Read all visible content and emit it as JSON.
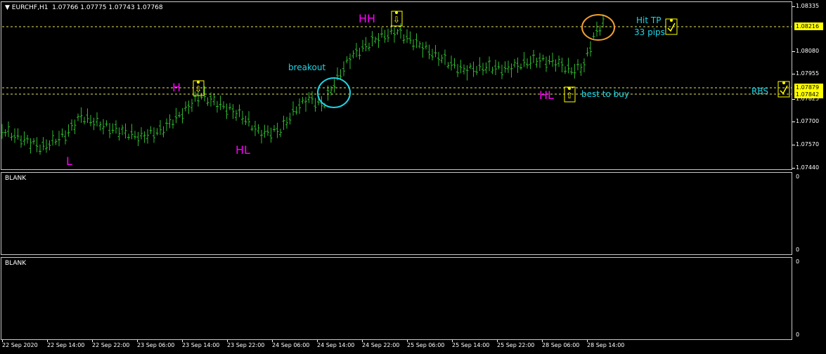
{
  "symbol_info": "EURCHF,H1  1.07766 1.07775 1.07743 1.07768",
  "colors": {
    "bars": "#2eb82e",
    "level_lines": "#e6e65a",
    "pink_text": "#ff00ff",
    "cyan_text": "#1ed6e6",
    "cyan_circle": "#1ed6e6",
    "orange_circle": "#f0a030",
    "marker_box": "#ffff00"
  },
  "price_scale": [
    "1.08335",
    "1.08080",
    "1.07955",
    "1.07825",
    "1.07700",
    "1.07570",
    "1.07440"
  ],
  "price_tags": [
    "1.08216",
    "1.07879",
    "1.07842"
  ],
  "sub_panes": [
    {
      "label": "BLANK",
      "scale_top": "0",
      "scale_bottom": "0"
    },
    {
      "label": "BLANK",
      "scale_top": "0",
      "scale_bottom": "0"
    }
  ],
  "time_axis": [
    "22 Sep 2020",
    "22 Sep 14:00",
    "22 Sep 22:00",
    "23 Sep 06:00",
    "23 Sep 14:00",
    "23 Sep 22:00",
    "24 Sep 06:00",
    "24 Sep 14:00",
    "24 Sep 22:00",
    "25 Sep 06:00",
    "25 Sep 14:00",
    "25 Sep 22:00",
    "28 Sep 06:00",
    "28 Sep 14:00"
  ],
  "annotations": {
    "L": "L",
    "H": "H",
    "HL_left": "HL",
    "HH": "HH",
    "HL_right": "HL",
    "breakout": "breakout",
    "hit_tp": "Hit TP",
    "pips": "33 pips",
    "best_to_buy": "best to buy",
    "rbs": "RBS"
  },
  "markers": [
    {
      "icon": "down-arrow-icon"
    },
    {
      "icon": "down-arrow-icon"
    },
    {
      "icon": "up-arrow-icon"
    },
    {
      "icon": "checkmark-icon"
    },
    {
      "icon": "checkmark-icon"
    }
  ]
}
